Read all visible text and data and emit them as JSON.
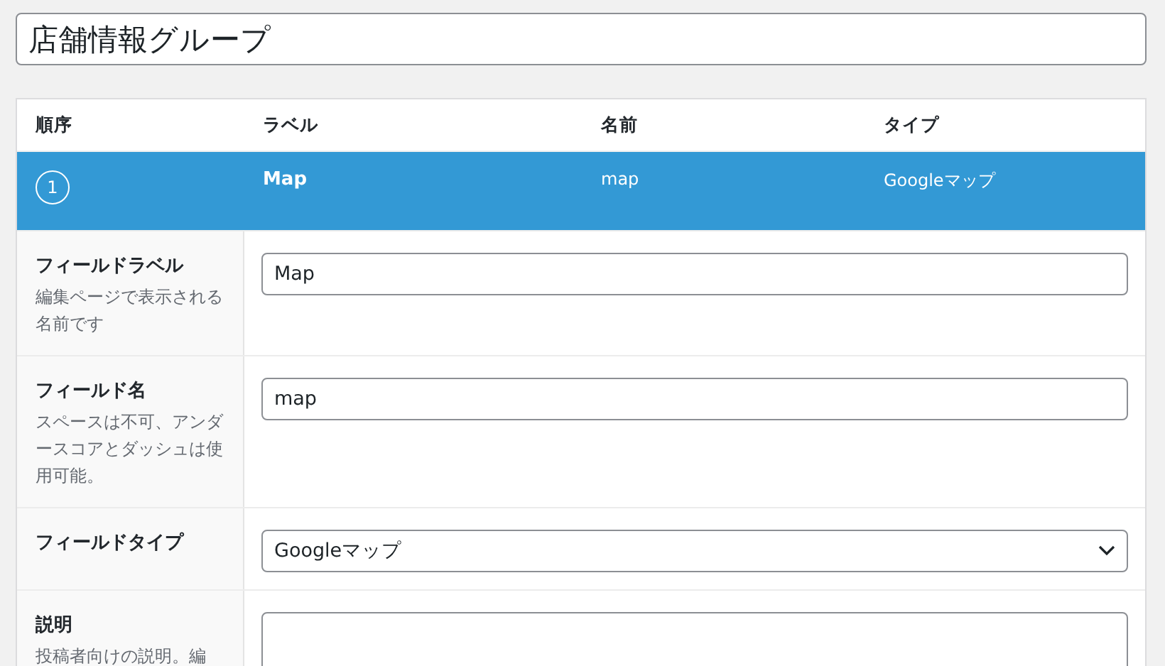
{
  "group_title": {
    "value": "店舗情報グループ"
  },
  "table": {
    "columns": [
      "順序",
      "ラベル",
      "名前",
      "タイプ"
    ],
    "field": {
      "order": "1",
      "label": "Map",
      "name": "map",
      "type": "Googleマップ",
      "selected": true
    },
    "settings": [
      {
        "kind": "text",
        "label": "フィールドラベル",
        "help": "編集ページで表示される名前です",
        "value": "Map"
      },
      {
        "kind": "text",
        "label": "フィールド名",
        "help": "スペースは不可、アンダースコアとダッシュは使用可能。",
        "value": "map"
      },
      {
        "kind": "select",
        "label": "フィールドタイプ",
        "value": "Googleマップ"
      },
      {
        "kind": "textarea",
        "label": "説明",
        "help": "投稿者向けの説明。編"
      }
    ]
  }
}
